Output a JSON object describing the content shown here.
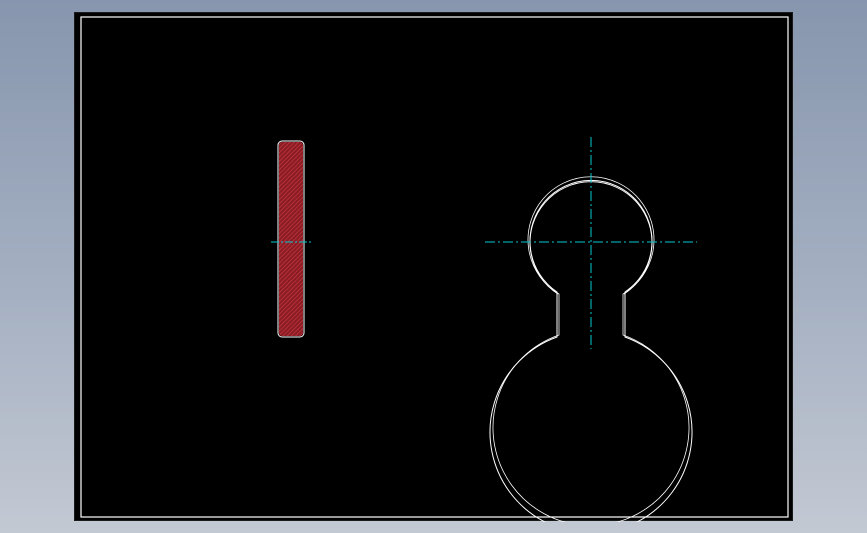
{
  "drawing": {
    "background_color": "#000000",
    "border_color": "#ffffff",
    "outline_color": "#ffffff",
    "centerline_color": "#00c8d2",
    "hatch_fill_color": "#8a1c24",
    "hatch_line_color": "#d03a45",
    "views": [
      {
        "id": "side-view",
        "description_icon": "bar-section-view",
        "hatched": true
      },
      {
        "id": "front-view",
        "description_icon": "slotted-washer-view",
        "hatched": false
      }
    ]
  }
}
